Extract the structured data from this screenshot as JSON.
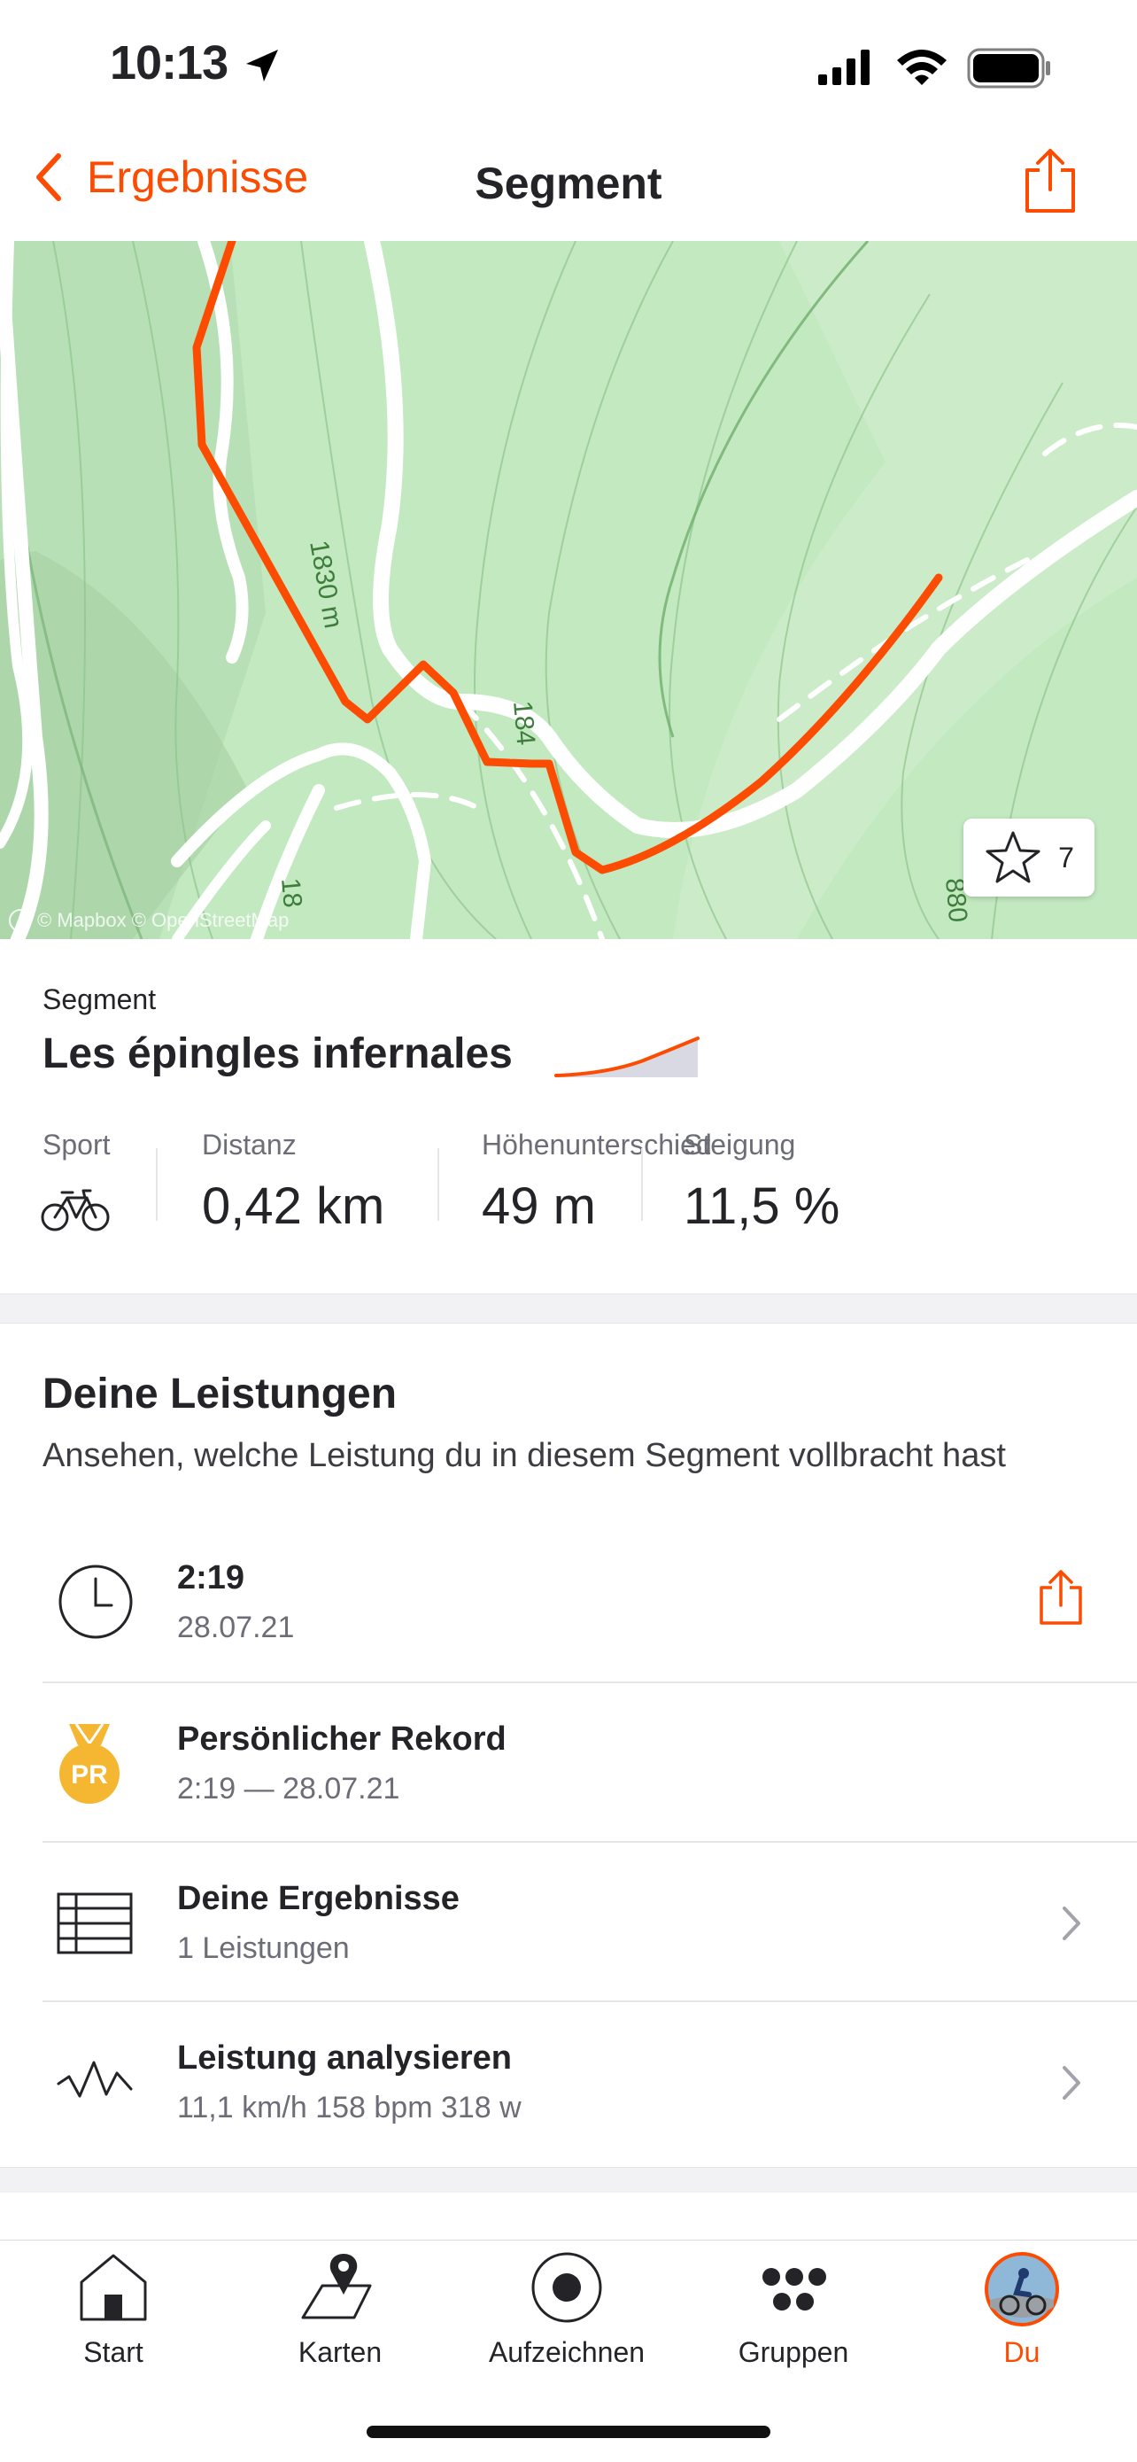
{
  "status_bar": {
    "time": "10:13"
  },
  "nav": {
    "back_label": "Ergebnisse",
    "title": "Segment"
  },
  "map": {
    "contour_labels": [
      "1830 m",
      "184",
      "18",
      "880"
    ],
    "attribution": "© Mapbox © OpenStreetMap",
    "star_count": "7"
  },
  "segment": {
    "label": "Segment",
    "name": "Les épingles infernales",
    "stats": {
      "sport_label": "Sport",
      "distance_label": "Distanz",
      "distance_value": "0,42 km",
      "elevation_label": "Höhenunterschied",
      "elevation_value": "49 m",
      "grade_label": "Steigung",
      "grade_value": "11,5 %"
    }
  },
  "performances": {
    "title": "Deine Leistungen",
    "subtitle": "Ansehen, welche Leistung du in diesem Segment vollbracht hast",
    "items": [
      {
        "title": "2:19",
        "subtitle": "28.07.21",
        "icon": "clock-icon"
      },
      {
        "title": "Persönlicher Rekord",
        "subtitle": "2:19 — 28.07.21",
        "icon": "pr-medal-icon",
        "badge": "PR"
      },
      {
        "title": "Deine Ergebnisse",
        "subtitle": "1 Leistungen",
        "icon": "table-icon"
      },
      {
        "title": "Leistung analysieren",
        "subtitle": "11,1 km/h 158 bpm 318 w",
        "icon": "analysis-icon"
      }
    ]
  },
  "tabbar": {
    "items": [
      {
        "label": "Start",
        "icon": "home-icon"
      },
      {
        "label": "Karten",
        "icon": "map-icon"
      },
      {
        "label": "Aufzeichnen",
        "icon": "record-icon"
      },
      {
        "label": "Gruppen",
        "icon": "groups-icon"
      },
      {
        "label": "Du",
        "icon": "avatar",
        "active": true
      }
    ]
  },
  "colors": {
    "accent": "#fc4c02",
    "map_green": "#bfe6bf",
    "pr_gold": "#f5b731"
  }
}
